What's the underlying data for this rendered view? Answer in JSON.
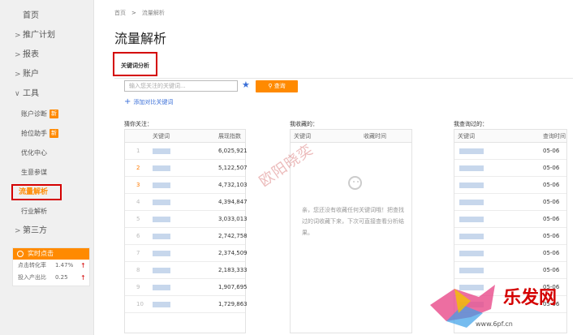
{
  "sidebar": {
    "home": "首页",
    "items": [
      {
        "label": "推广计划",
        "chevron": ">"
      },
      {
        "label": "报表",
        "chevron": ">"
      },
      {
        "label": "账户",
        "chevron": ">"
      },
      {
        "label": "工具",
        "chevron": "∨"
      }
    ],
    "tools": [
      {
        "label": "账户诊断",
        "badge": "新"
      },
      {
        "label": "抢位助手",
        "badge": "新"
      },
      {
        "label": "优化中心",
        "badge": ""
      },
      {
        "label": "生意参谋",
        "badge": ""
      },
      {
        "label": "流量解析",
        "badge": ""
      },
      {
        "label": "行业解析",
        "badge": ""
      }
    ],
    "third": {
      "label": "第三方",
      "chevron": ">"
    },
    "realtime": {
      "title": "实时点击",
      "rows": [
        {
          "label": "点击转化率",
          "value": "1.47%",
          "trend": "↑"
        },
        {
          "label": "投入产出比",
          "value": "0.25",
          "trend": "↑"
        }
      ]
    }
  },
  "breadcrumb": {
    "home": "首页",
    "separator": ">",
    "current": "流量解析"
  },
  "page_title": "流量解析",
  "tab": {
    "label": "关键词分析"
  },
  "search": {
    "placeholder": "输入您关注的关键词...",
    "button": "查询"
  },
  "add_link": "添加对比关键词",
  "guess": {
    "title": "猜你关注：",
    "headers": [
      "关键词",
      "展现指数"
    ],
    "rows": [
      {
        "rank": "1",
        "value": "6,025,921"
      },
      {
        "rank": "2",
        "value": "5,122,507"
      },
      {
        "rank": "3",
        "value": "4,732,103"
      },
      {
        "rank": "4",
        "value": "4,394,847"
      },
      {
        "rank": "5",
        "value": "3,033,013"
      },
      {
        "rank": "6",
        "value": "2,742,758"
      },
      {
        "rank": "7",
        "value": "2,374,509"
      },
      {
        "rank": "8",
        "value": "2,183,333"
      },
      {
        "rank": "9",
        "value": "1,907,695"
      },
      {
        "rank": "10",
        "value": "1,729,863"
      }
    ]
  },
  "fav": {
    "title": "我收藏的：",
    "headers": [
      "关键词",
      "收藏时间"
    ],
    "empty_text": "亲，您还没有收藏任何关键词哦！把查找过的词收藏下来，下次可直接查看分析结果。"
  },
  "history": {
    "title": "我查询过的：",
    "headers": [
      "关键词",
      "查询时间"
    ],
    "dates": [
      "05-06",
      "05-06",
      "05-06",
      "05-06",
      "05-06",
      "05-06",
      "05-06",
      "05-06",
      "05-06",
      "05-06"
    ]
  },
  "watermark": "欧阳晓奕",
  "logo": {
    "text": "乐发网",
    "url": "www.6pf.cn"
  },
  "colors": {
    "accent": "#ff8a00",
    "link": "#3a6fd8",
    "highlight_border": "#d40000"
  }
}
